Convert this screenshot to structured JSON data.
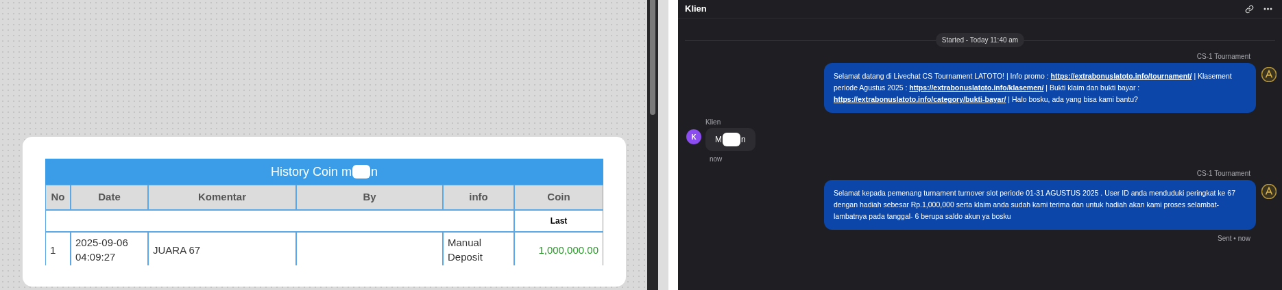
{
  "history_table": {
    "title_start": "History Coin m",
    "title_end": "n",
    "columns": [
      "No",
      "Date",
      "Komentar",
      "By",
      "info",
      "Coin"
    ],
    "summary_label": "Last",
    "rows": [
      {
        "no": "1",
        "date": "2025-09-06 04:09:27",
        "komentar": "JUARA 67",
        "by": "",
        "info": "Manual Deposit",
        "coin": "1,000,000.00"
      }
    ]
  },
  "chat": {
    "title": "Klien",
    "started": "Started - Today 11:40 am",
    "messages": [
      {
        "kind": "agent",
        "sender": "CS-1 Tournament",
        "parts": [
          {
            "t": "Selamat datang di Livechat CS Tournament LATOTO! | Info promo : "
          },
          {
            "link": "https://extrabonuslatoto.info/tournament/"
          },
          {
            "t": " | Klasement periode Agustus 2025 : "
          },
          {
            "link": "https://extrabonuslatoto.info/klasemen/"
          },
          {
            "t": " | Bukti klaim dan bukti bayar : "
          },
          {
            "link": "https://extrabonuslatoto.info/category/bukti-bayar/"
          },
          {
            "t": " | Halo bosku, ada yang bisa kami bantu?"
          }
        ]
      },
      {
        "kind": "client",
        "sender": "Klien",
        "initial": "K",
        "text_start": "M",
        "text_end": "n",
        "time": "now"
      },
      {
        "kind": "agent",
        "sender": "CS-1 Tournament",
        "parts": [
          {
            "t": "Selamat kepada pemenang turnament turnover slot periode 01-31 AGUSTUS 2025 . User ID anda menduduki peringkat ke 67 dengan hadiah sebesar Rp.1,000,000 serta klaim anda sudah kami terima dan untuk hadiah akan kami proses selambat-lambatnya pada tanggal- 6 berupa saldo akun ya bosku"
          }
        ],
        "status": "Sent",
        "separator": "•",
        "time": "now"
      }
    ]
  }
}
